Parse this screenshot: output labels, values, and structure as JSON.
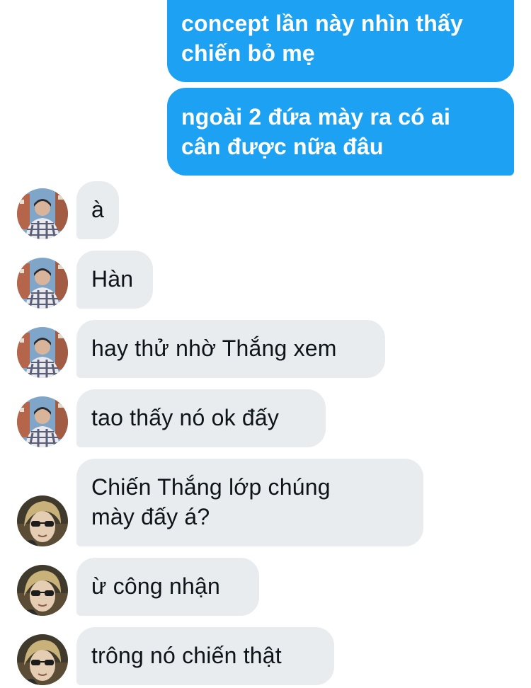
{
  "accent_color": "#1da1f2",
  "incoming_bubble_color": "#e8ecef",
  "messages": [
    {
      "direction": "outgoing",
      "text": "concept lần này nhìn thấy\nchiến bỏ mẹ"
    },
    {
      "direction": "outgoing",
      "text": "ngoài 2 đứa mày ra có ai\ncân được nữa đâu"
    },
    {
      "direction": "incoming",
      "sender_avatar": "avatar-a",
      "text": "à"
    },
    {
      "direction": "incoming",
      "sender_avatar": "avatar-a",
      "text": "Hàn"
    },
    {
      "direction": "incoming",
      "sender_avatar": "avatar-a",
      "text": "hay thử nhờ Thắng xem"
    },
    {
      "direction": "incoming",
      "sender_avatar": "avatar-a",
      "text": "tao thấy nó ok đấy"
    },
    {
      "direction": "incoming",
      "sender_avatar": "avatar-b",
      "text": "Chiến Thắng lớp chúng\nmày đấy á?"
    },
    {
      "direction": "incoming",
      "sender_avatar": "avatar-b",
      "text": "ừ công nhận"
    },
    {
      "direction": "incoming",
      "sender_avatar": "avatar-b",
      "text": "trông nó chiến thật"
    }
  ]
}
